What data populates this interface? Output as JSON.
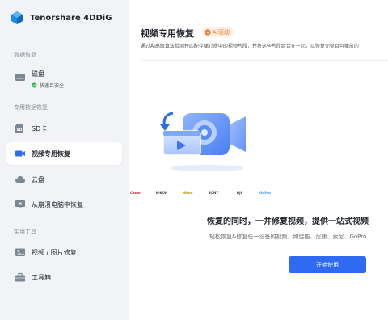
{
  "app": {
    "name": "Tenorshare 4DDiG"
  },
  "sidebar": {
    "sections": [
      {
        "label": "数据恢复"
      },
      {
        "label": "专用数据恢复"
      },
      {
        "label": "实用工具"
      }
    ],
    "items": [
      {
        "label": "磁盘",
        "sub": "快速且安全",
        "icon": "disk-icon"
      },
      {
        "label": "SD卡",
        "icon": "sd-card-icon"
      },
      {
        "label": "视频专用恢复",
        "icon": "video-camera-icon",
        "active": true
      },
      {
        "label": "云盘",
        "icon": "cloud-drive-icon"
      },
      {
        "label": "从崩溃电脑中恢复",
        "icon": "crashed-computer-icon"
      },
      {
        "label": "视频 / 图片修复",
        "icon": "photo-repair-icon"
      },
      {
        "label": "工具箱",
        "icon": "toolbox-icon"
      }
    ]
  },
  "main": {
    "title": "视频专用恢复",
    "badge": "AI驱动",
    "description": "通过AI高级算法检测并匹配存储介质中的视频片段，并将这些片段组合在一起，以恢复完整且可播放的",
    "brands": [
      "Canon",
      "NIKON",
      "Nikon",
      "SONY",
      "DJI",
      "GoPro"
    ],
    "headline": "恢复的同时，一并修复视频，提供一站式视频",
    "subline": "轻松恢复&修复任一设备的视频，如佳能、尼康、索尼、GoPro",
    "button": "开始使用"
  },
  "colors": {
    "accent": "#2f6bf2",
    "badge": "#f07020",
    "sidebar_bg": "#f1f3f7"
  }
}
